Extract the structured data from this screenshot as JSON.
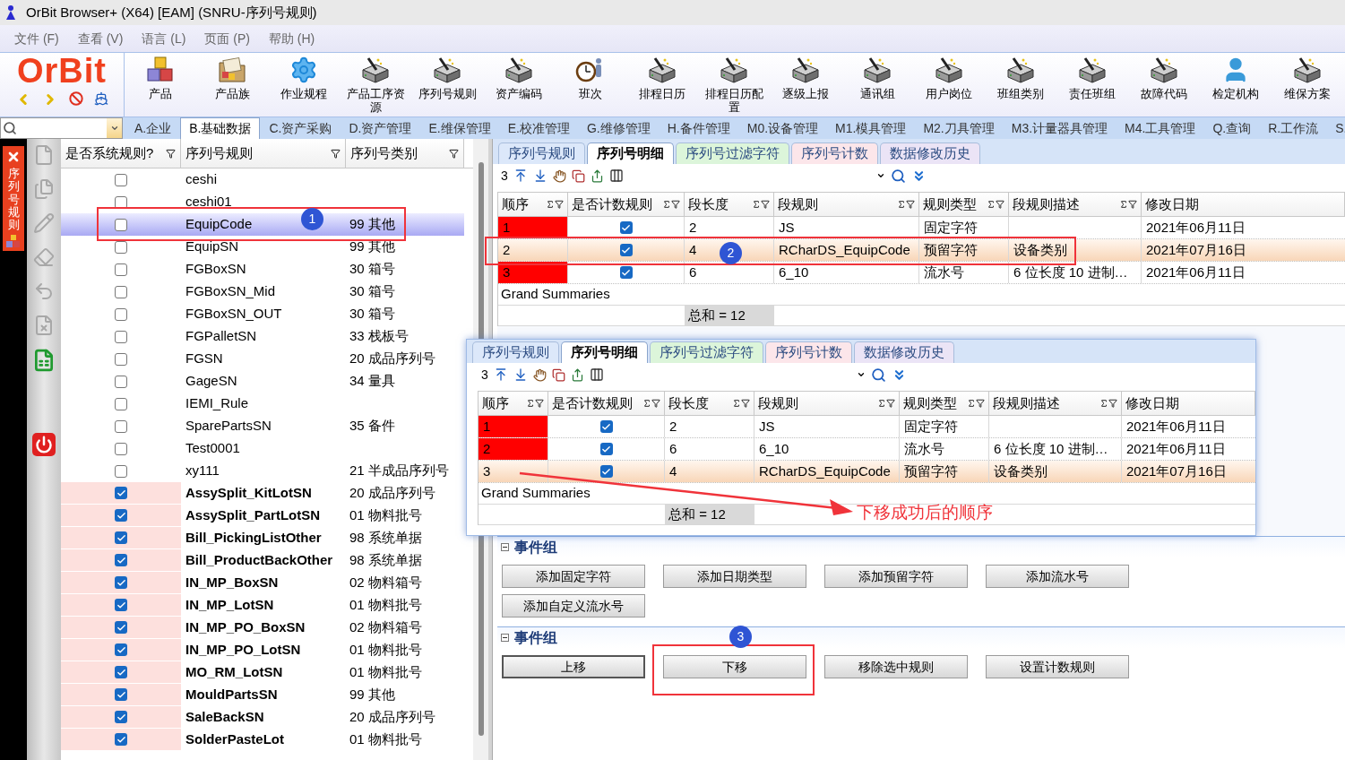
{
  "window": {
    "title": "OrBit Browser+ (X64) [EAM] (SNRU-序列号规则)"
  },
  "menu": [
    "文件 (F)",
    "查看 (V)",
    "语言 (L)",
    "页面 (P)",
    "帮助 (H)"
  ],
  "logo": "OrBit",
  "toolbar": [
    {
      "label": "产品",
      "kind": "cubes"
    },
    {
      "label": "产品族",
      "kind": "folder"
    },
    {
      "label": "作业规程",
      "kind": "gear"
    },
    {
      "label": "产品工序资源",
      "kind": "machine"
    },
    {
      "label": "序列号规则",
      "kind": "machine"
    },
    {
      "label": "资产编码",
      "kind": "machine"
    },
    {
      "label": "班次",
      "kind": "clock"
    },
    {
      "label": "排程日历",
      "kind": "machine"
    },
    {
      "label": "排程日历配置",
      "kind": "machine"
    },
    {
      "label": "逐级上报",
      "kind": "machine"
    },
    {
      "label": "通讯组",
      "kind": "machine"
    },
    {
      "label": "用户岗位",
      "kind": "machine"
    },
    {
      "label": "班组类别",
      "kind": "machine"
    },
    {
      "label": "责任班组",
      "kind": "machine"
    },
    {
      "label": "故障代码",
      "kind": "machine"
    },
    {
      "label": "检定机构",
      "kind": "person"
    },
    {
      "label": "维保方案",
      "kind": "machine"
    }
  ],
  "module_tabs": [
    {
      "label": "A.企业",
      "selected": false
    },
    {
      "label": "B.基础数据",
      "selected": true
    },
    {
      "label": "C.资产采购",
      "selected": false
    },
    {
      "label": "D.资产管理",
      "selected": false
    },
    {
      "label": "E.维保管理",
      "selected": false
    },
    {
      "label": "E.校准管理",
      "selected": false
    },
    {
      "label": "G.维修管理",
      "selected": false
    },
    {
      "label": "H.备件管理",
      "selected": false
    },
    {
      "label": "M0.设备管理",
      "selected": false
    },
    {
      "label": "M1.模具管理",
      "selected": false
    },
    {
      "label": "M2.刀具管理",
      "selected": false
    },
    {
      "label": "M3.计量器具管理",
      "selected": false
    },
    {
      "label": "M4.工具管理",
      "selected": false
    },
    {
      "label": "Q.查询",
      "selected": false
    },
    {
      "label": "R.工作流",
      "selected": false
    },
    {
      "label": "S.",
      "selected": false
    }
  ],
  "side_tab": {
    "label": "序列号规则"
  },
  "rules": {
    "columns": [
      {
        "label": "是否系统规则?"
      },
      {
        "label": "序列号规则"
      },
      {
        "label": "序列号类别"
      }
    ],
    "rows": [
      {
        "system": false,
        "name": "ceshi",
        "selected": false
      },
      {
        "system": false,
        "name": "ceshi01",
        "selected": false
      },
      {
        "system": false,
        "name": "EquipCode",
        "category": "99 其他",
        "selected": true
      },
      {
        "system": false,
        "name": "EquipSN",
        "category": "99 其他",
        "selected": false
      },
      {
        "system": false,
        "name": "FGBoxSN",
        "category": "30 箱号",
        "selected": false
      },
      {
        "system": false,
        "name": "FGBoxSN_Mid",
        "category": "30 箱号",
        "selected": false
      },
      {
        "system": false,
        "name": "FGBoxSN_OUT",
        "category": "30 箱号",
        "selected": false
      },
      {
        "system": false,
        "name": "FGPalletSN",
        "category": "33 栈板号",
        "selected": false
      },
      {
        "system": false,
        "name": "FGSN",
        "category": "20 成品序列号",
        "selected": false
      },
      {
        "system": false,
        "name": "GageSN",
        "category": "34 量具",
        "selected": false
      },
      {
        "system": false,
        "name": "IEMI_Rule",
        "selected": false
      },
      {
        "system": false,
        "name": "SparePartsSN",
        "category": "35 备件",
        "selected": false
      },
      {
        "system": false,
        "name": "Test0001",
        "selected": false
      },
      {
        "system": false,
        "name": "xy111",
        "category": "21 半成品序列号",
        "selected": false
      },
      {
        "system": true,
        "name": "AssySplit_KitLotSN",
        "category": "20 成品序列号",
        "selected": false
      },
      {
        "system": true,
        "name": "AssySplit_PartLotSN",
        "category": "01 物料批号",
        "selected": false
      },
      {
        "system": true,
        "name": "Bill_PickingListOther",
        "category": "98 系统单据",
        "selected": false
      },
      {
        "system": true,
        "name": "Bill_ProductBackOther",
        "category": "98 系统单据",
        "selected": false
      },
      {
        "system": true,
        "name": "IN_MP_BoxSN",
        "category": "02 物料箱号",
        "selected": false
      },
      {
        "system": true,
        "name": "IN_MP_LotSN",
        "category": "01 物料批号",
        "selected": false
      },
      {
        "system": true,
        "name": "IN_MP_PO_BoxSN",
        "category": "02 物料箱号",
        "selected": false
      },
      {
        "system": true,
        "name": "IN_MP_PO_LotSN",
        "category": "01 物料批号",
        "selected": false
      },
      {
        "system": true,
        "name": "MO_RM_LotSN",
        "category": "01 物料批号",
        "selected": false
      },
      {
        "system": true,
        "name": "MouldPartsSN",
        "category": "99 其他",
        "selected": false
      },
      {
        "system": true,
        "name": "SaleBackSN",
        "category": "20 成品序列号",
        "selected": false
      },
      {
        "system": true,
        "name": "SolderPasteLot",
        "category": "01 物料批号",
        "selected": false
      }
    ]
  },
  "detail": {
    "tabs": [
      {
        "label": "序列号规则",
        "selected": false,
        "color": "#dce8fa"
      },
      {
        "label": "序列号明细",
        "selected": true,
        "color": "#ffffff"
      },
      {
        "label": "序列号过滤字符",
        "selected": false,
        "color": "#dcf5da"
      },
      {
        "label": "序列号计数",
        "selected": false,
        "color": "#fce6ea"
      },
      {
        "label": "数据修改历史",
        "selected": false,
        "color": "#ebe4f6"
      }
    ],
    "count": "3",
    "columns": [
      {
        "label": "顺序",
        "filter": true
      },
      {
        "label": "是否计数规则",
        "filter": true
      },
      {
        "label": "段长度",
        "filter": true
      },
      {
        "label": "段规则",
        "filter": true
      },
      {
        "label": "规则类型",
        "filter": true
      },
      {
        "label": "段规则描述",
        "filter": true
      },
      {
        "label": "修改日期",
        "filter": false
      }
    ],
    "rows": [
      {
        "order": "1",
        "counted": true,
        "length": "2",
        "rule": "JS",
        "type": "固定字符",
        "date": "2021年06月11日",
        "selected": false
      },
      {
        "order": "2",
        "counted": true,
        "length": "4",
        "rule": "RCharDS_EquipCode",
        "type": "预留字符",
        "desc": "设备类别",
        "date": "2021年07月16日",
        "selected": true
      },
      {
        "order": "3",
        "counted": true,
        "length": "6",
        "rule": "6_10",
        "type": "流水号",
        "desc": "6 位长度 10 进制…",
        "date": "2021年06月11日",
        "selected": false
      }
    ],
    "summary_label": "Grand Summaries",
    "sum": "总和 = 12"
  },
  "overlay": {
    "tabs": [
      {
        "label": "序列号规则",
        "selected": false,
        "color": "#dce8fa"
      },
      {
        "label": "序列号明细",
        "selected": true,
        "color": "#ffffff"
      },
      {
        "label": "序列号过滤字符",
        "selected": false,
        "color": "#dcf5da"
      },
      {
        "label": "序列号计数",
        "selected": false,
        "color": "#fce6ea"
      },
      {
        "label": "数据修改历史",
        "selected": false,
        "color": "#ebe4f6"
      }
    ],
    "count": "3",
    "columns": [
      {
        "label": "顺序",
        "filter": true
      },
      {
        "label": "是否计数规则",
        "filter": true
      },
      {
        "label": "段长度",
        "filter": true
      },
      {
        "label": "段规则",
        "filter": true
      },
      {
        "label": "规则类型",
        "filter": true
      },
      {
        "label": "段规则描述",
        "filter": true
      },
      {
        "label": "修改日期",
        "filter": false
      }
    ],
    "rows": [
      {
        "order": "1",
        "counted": true,
        "length": "2",
        "rule": "JS",
        "type": "固定字符",
        "date": "2021年06月11日",
        "selected": false
      },
      {
        "order": "2",
        "counted": true,
        "length": "6",
        "rule": "6_10",
        "type": "流水号",
        "desc": "6 位长度 10 进制…",
        "date": "2021年06月11日",
        "selected": false
      },
      {
        "order": "3",
        "counted": true,
        "length": "4",
        "rule": "RCharDS_EquipCode",
        "type": "预留字符",
        "desc": "设备类别",
        "date": "2021年07月16日",
        "selected": true
      }
    ],
    "summary_label": "Grand Summaries",
    "sum": "总和 = 12"
  },
  "groups": [
    {
      "title": "事件组",
      "buttons": [
        {
          "label": "添加固定字符",
          "focused": false
        },
        {
          "label": "添加日期类型",
          "focused": false
        },
        {
          "label": "添加预留字符",
          "focused": false
        },
        {
          "label": "添加流水号",
          "focused": false
        },
        {
          "label": "添加自定义流水号",
          "focused": false
        }
      ]
    },
    {
      "title": "事件组",
      "buttons": [
        {
          "label": "上移",
          "focused": true
        },
        {
          "label": "下移",
          "focused": false
        },
        {
          "label": "移除选中规则",
          "focused": false
        },
        {
          "label": "设置计数规则",
          "focused": false
        }
      ]
    }
  ],
  "annotations": {
    "markers": [
      "1",
      "2",
      "3"
    ],
    "callout": "下移成功后的顺序"
  }
}
